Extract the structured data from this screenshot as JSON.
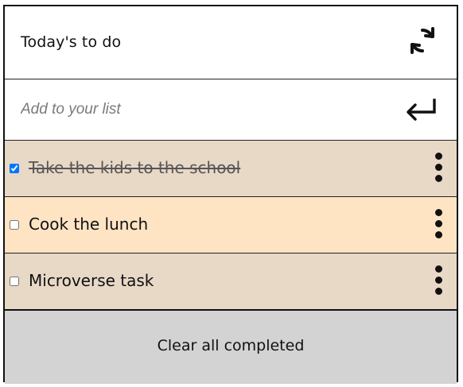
{
  "header": {
    "title": "Today's to do",
    "refresh_icon": "refresh-icon"
  },
  "add": {
    "placeholder": "Add to your list",
    "value": "",
    "enter_icon": "enter-icon"
  },
  "tasks": [
    {
      "label": "Take the kids to the school",
      "completed": true,
      "background": "#e8d8c6"
    },
    {
      "label": "Cook the lunch",
      "completed": false,
      "background": "#ffe4c4"
    },
    {
      "label": "Microverse task",
      "completed": false,
      "background": "#e8d8c6"
    }
  ],
  "footer": {
    "clear_label": "Clear all completed",
    "background": "#d3d3d3"
  },
  "colors": {
    "border": "#111111",
    "text": "#111111",
    "placeholder": "#7a7a7a"
  }
}
